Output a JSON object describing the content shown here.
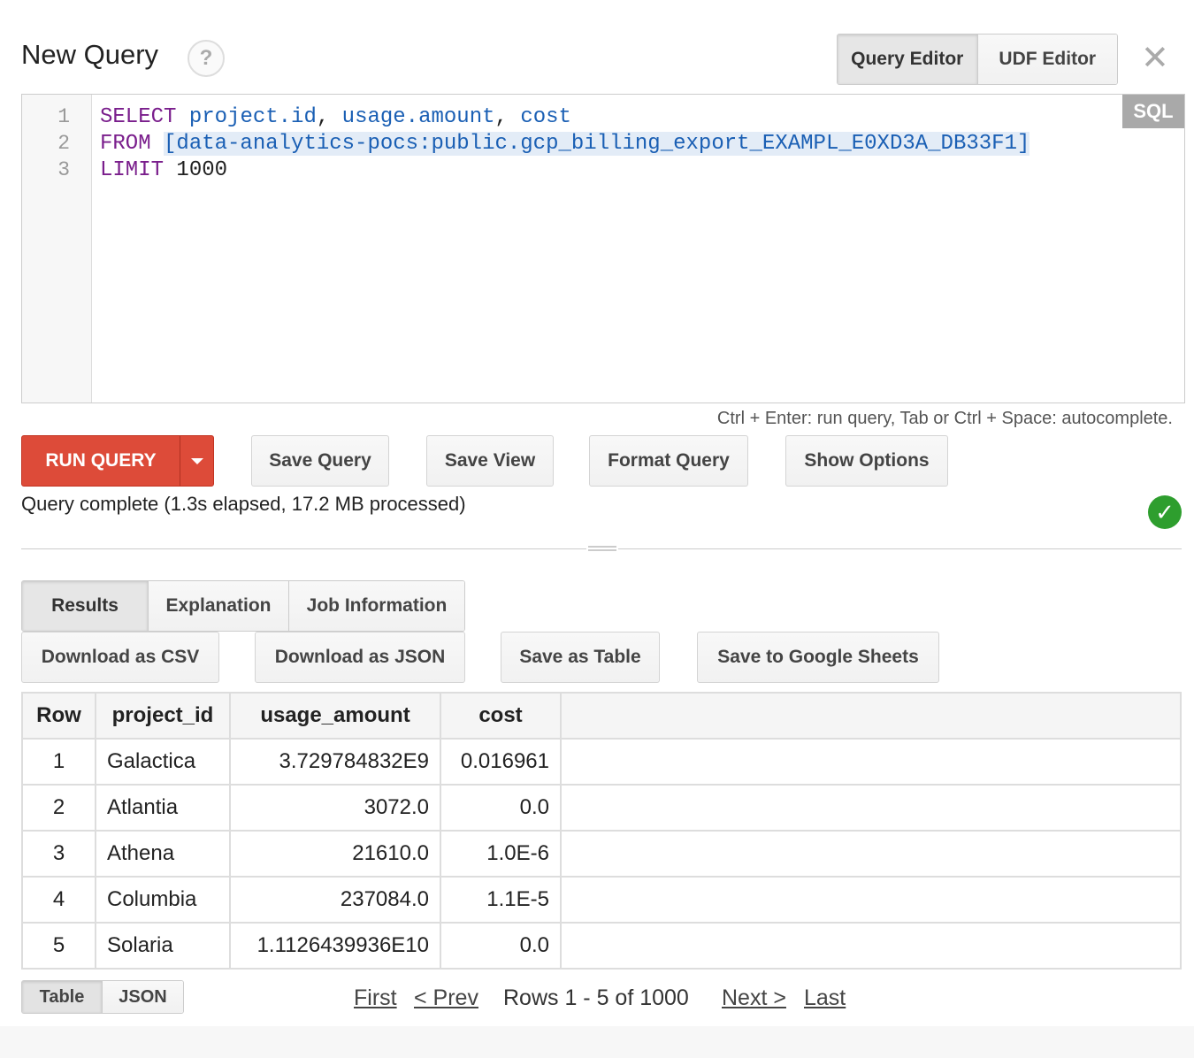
{
  "header": {
    "title": "New Query",
    "help_icon": "?",
    "tabs": [
      {
        "label": "Query Editor",
        "active": true
      },
      {
        "label": "UDF Editor",
        "active": false
      }
    ],
    "close_icon": "✕"
  },
  "editor": {
    "language_badge": "SQL",
    "line_numbers": [
      "1",
      "2",
      "3"
    ],
    "lines": {
      "l1": {
        "kw": "SELECT",
        "a": "project.id",
        "c1": ", ",
        "b": "usage.amount",
        "c2": ", ",
        "c": "cost"
      },
      "l2": {
        "kw": "FROM",
        "table": "[data-analytics-pocs:public.gcp_billing_export_EXAMPL_E0XD3A_DB33F1]"
      },
      "l3": {
        "kw": "LIMIT",
        "value": "1000"
      }
    },
    "hint": "Ctrl + Enter: run query, Tab or Ctrl + Space: autocomplete."
  },
  "actions": {
    "run": "RUN QUERY",
    "save_query": "Save Query",
    "save_view": "Save View",
    "format_query": "Format Query",
    "show_options": "Show Options"
  },
  "status": {
    "text": "Query complete (1.3s elapsed, 17.2 MB processed)",
    "icon": "check-icon",
    "icon_color": "#2e9e2e"
  },
  "result_tabs": [
    {
      "label": "Results",
      "active": true
    },
    {
      "label": "Explanation",
      "active": false
    },
    {
      "label": "Job Information",
      "active": false
    }
  ],
  "exports": {
    "csv": "Download as CSV",
    "json": "Download as JSON",
    "table": "Save as Table",
    "sheets": "Save to Google Sheets"
  },
  "table": {
    "headers": [
      "Row",
      "project_id",
      "usage_amount",
      "cost"
    ],
    "rows": [
      [
        "1",
        "Galactica",
        "3.729784832E9",
        "0.016961"
      ],
      [
        "2",
        "Atlantia",
        "3072.0",
        "0.0"
      ],
      [
        "3",
        "Athena",
        "21610.0",
        "1.0E-6"
      ],
      [
        "4",
        "Columbia",
        "237084.0",
        "1.1E-5"
      ],
      [
        "5",
        "Solaria",
        "1.1126439936E10",
        "0.0"
      ]
    ]
  },
  "view_toggle": [
    {
      "label": "Table",
      "active": true
    },
    {
      "label": "JSON",
      "active": false
    }
  ],
  "pager": {
    "first": "First",
    "prev": "< Prev",
    "summary": "Rows 1 - 5 of 1000",
    "next": "Next >",
    "last": "Last"
  },
  "colors": {
    "run_button": "#dd4b39",
    "keyword": "#7a1e8c",
    "identifier": "#1a5fb4"
  }
}
